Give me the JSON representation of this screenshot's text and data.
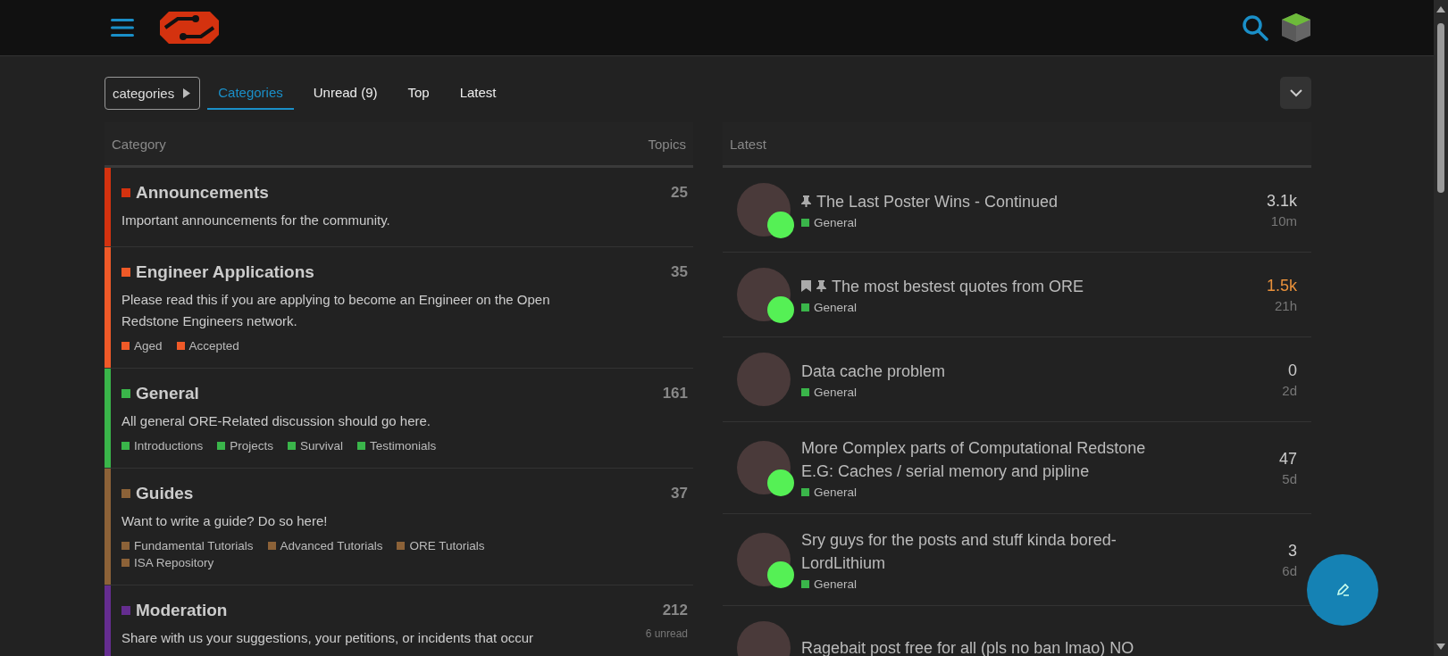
{
  "nav": {
    "breadcrumb": "categories",
    "tabs": [
      {
        "label": "Categories",
        "selected": true
      },
      {
        "label": "Unread (9)",
        "selected": false
      },
      {
        "label": "Top",
        "selected": false
      },
      {
        "label": "Latest",
        "selected": false
      }
    ]
  },
  "categories_table": {
    "columns": [
      "Category",
      "Topics"
    ],
    "rows": [
      {
        "name": "Announcements",
        "color": "#d4320f",
        "description": "Important announcements for the community.",
        "topics": "25",
        "subcategories": []
      },
      {
        "name": "Engineer Applications",
        "color": "#f05a28",
        "description": "Please read this if you are applying to become an Engineer on the Open Redstone Engineers network.",
        "topics": "35",
        "subcategories": [
          {
            "name": "Aged",
            "color": "#f05a28"
          },
          {
            "name": "Accepted",
            "color": "#f05a28"
          }
        ]
      },
      {
        "name": "General",
        "color": "#3ab54a",
        "description": "All general ORE-Related discussion should go here.",
        "topics": "161",
        "subcategories": [
          {
            "name": "Introductions",
            "color": "#3ab54a"
          },
          {
            "name": "Projects",
            "color": "#3ab54a"
          },
          {
            "name": "Survival",
            "color": "#3ab54a"
          },
          {
            "name": "Testimonials",
            "color": "#3ab54a"
          }
        ]
      },
      {
        "name": "Guides",
        "color": "#8c6238",
        "description": "Want to write a guide? Do so here!",
        "topics": "37",
        "subcategories": [
          {
            "name": "Fundamental Tutorials",
            "color": "#8c6238"
          },
          {
            "name": "Advanced Tutorials",
            "color": "#8c6238"
          },
          {
            "name": "ORE Tutorials",
            "color": "#8c6238"
          },
          {
            "name": "ISA Repository",
            "color": "#8c6238"
          }
        ]
      },
      {
        "name": "Moderation",
        "color": "#652d90",
        "description": "Share with us your suggestions, your petitions, or incidents that occur",
        "topics": "212",
        "unread": "6 unread",
        "subcategories": []
      }
    ]
  },
  "latest": {
    "heading": "Latest",
    "topics": [
      {
        "title": "The Last Poster Wins - Continued",
        "category": {
          "name": "General",
          "color": "#3ab54a"
        },
        "pinned": true,
        "bookmarked": false,
        "online": true,
        "replies": "3.1k",
        "hot": false,
        "age": "10m"
      },
      {
        "title": "The most bestest quotes from ORE",
        "category": {
          "name": "General",
          "color": "#3ab54a"
        },
        "pinned": true,
        "bookmarked": true,
        "online": true,
        "replies": "1.5k",
        "hot": true,
        "age": "21h"
      },
      {
        "title": "Data cache problem",
        "category": {
          "name": "General",
          "color": "#3ab54a"
        },
        "pinned": false,
        "bookmarked": false,
        "online": false,
        "replies": "0",
        "hot": false,
        "age": "2d"
      },
      {
        "title": "More Complex parts of Computational Redstone E.G: Caches / serial memory and pipline",
        "category": {
          "name": "General",
          "color": "#3ab54a"
        },
        "pinned": false,
        "bookmarked": false,
        "online": true,
        "replies": "47",
        "hot": false,
        "age": "5d"
      },
      {
        "title": "Sry guys for the posts and stuff kinda bored-LordLithium",
        "category": {
          "name": "General",
          "color": "#3ab54a"
        },
        "pinned": false,
        "bookmarked": false,
        "online": true,
        "replies": "3",
        "hot": false,
        "age": "6d"
      },
      {
        "title": "Ragebait post free for all (pls no ban lmao) NO",
        "pinned": false,
        "bookmarked": false,
        "online": false
      }
    ]
  }
}
